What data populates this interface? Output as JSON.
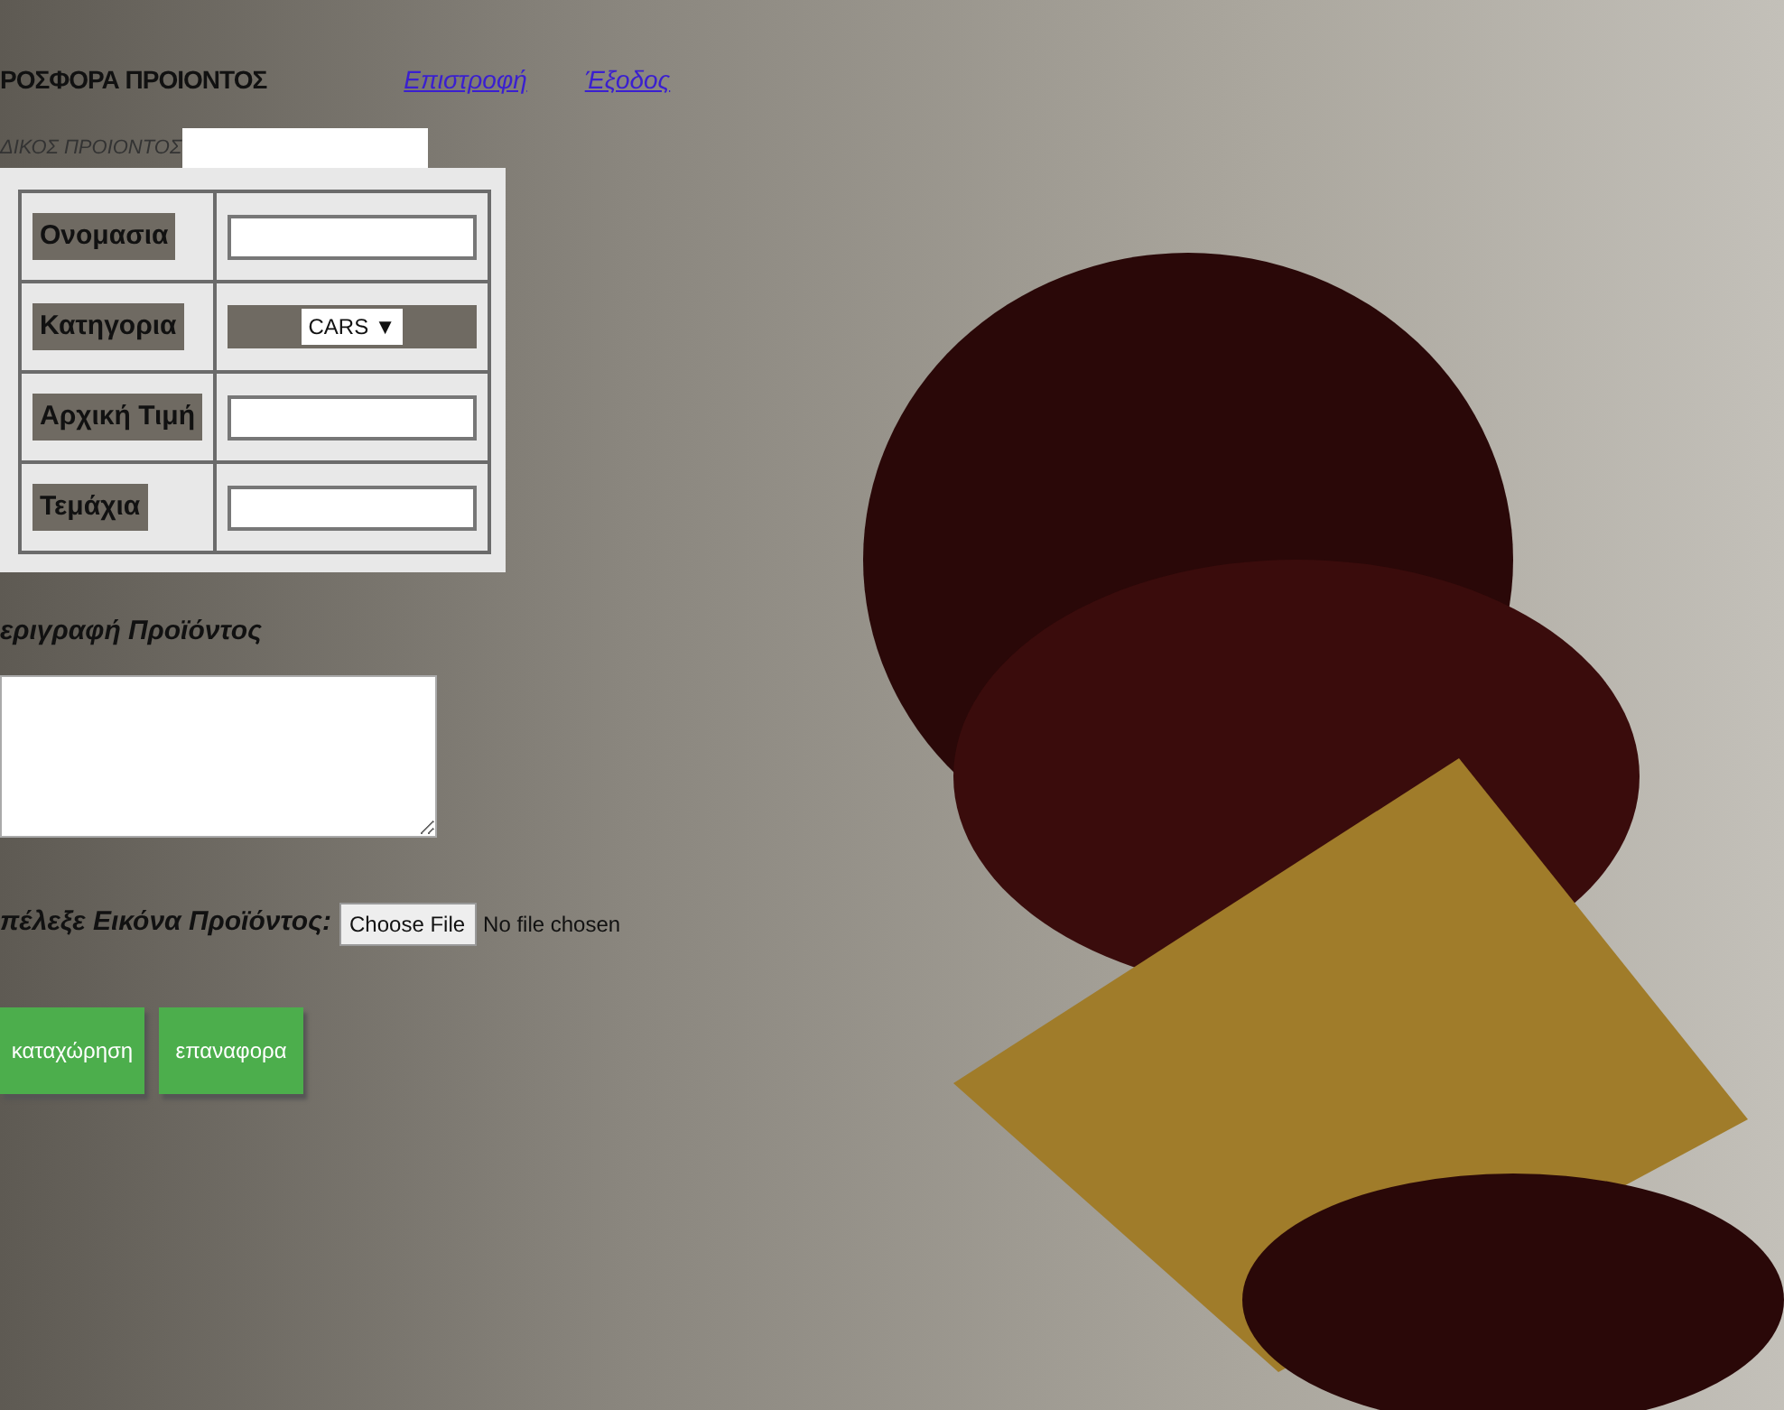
{
  "header": {
    "title": "ΡΟΣΦΟΡΑ ΠΡΟΙΟΝΤΟΣ",
    "links": [
      "Επιστροφή",
      "Έξοδος"
    ]
  },
  "code_field": {
    "label": "ΔΙΚΟΣ ΠΡΟΙΟΝΤΟΣ"
  },
  "form_rows": [
    {
      "kind": "text",
      "label": "Ονομασια"
    },
    {
      "kind": "select",
      "label": "Κατηγορια",
      "value": "CARS",
      "arrow": "▼"
    },
    {
      "kind": "text",
      "label": "Αρχική Τιμή"
    },
    {
      "kind": "text",
      "label": "Τεμάχια"
    }
  ],
  "description": {
    "label": "εριγραφή Προϊόντος"
  },
  "file_input": {
    "label": "πέλεξε Εικόνα Προϊόντος:",
    "button": "Choose File",
    "status": "No file chosen"
  },
  "buttons": [
    "καταχώρηση",
    "επαναφορα"
  ]
}
